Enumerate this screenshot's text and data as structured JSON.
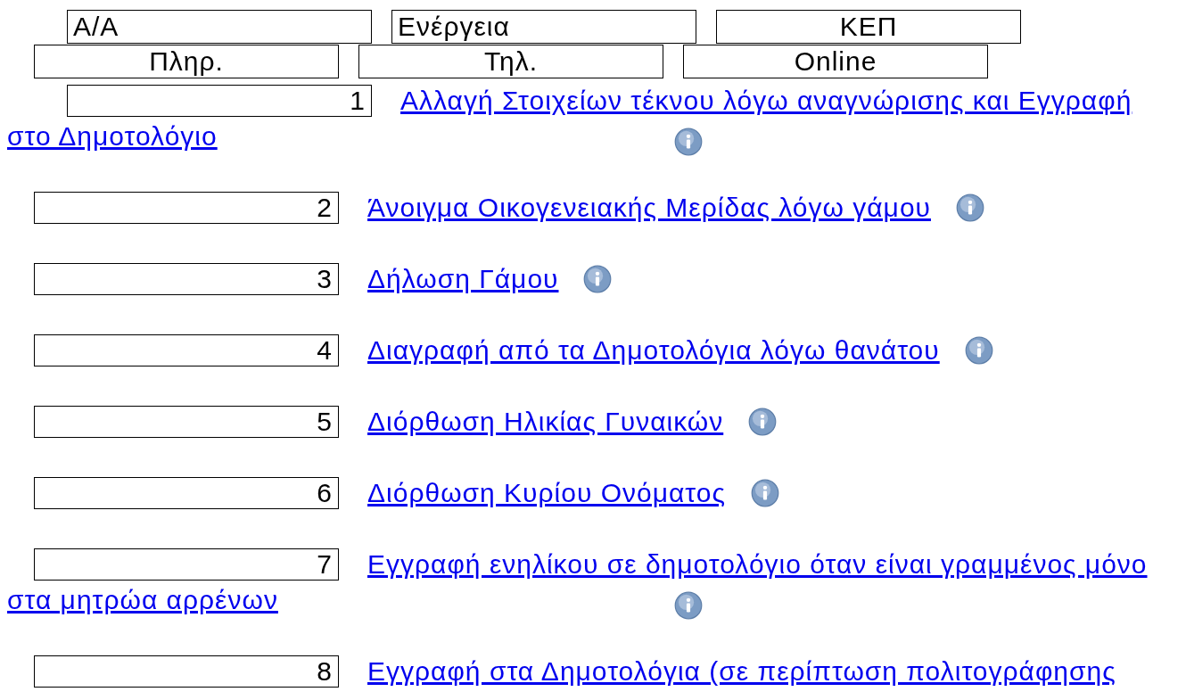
{
  "legend_rows": [
    [
      "Α/Α",
      "Ενέργεια",
      "ΚΕΠ"
    ],
    [
      "Πληρ.",
      "Τηλ.",
      "Online"
    ]
  ],
  "services": [
    {
      "number": "1",
      "title_lines": [
        "Αλλαγή Στοιχείων τέκνου λόγω αναγνώρισης και Εγγραφή",
        "στο Δημοτολόγιο"
      ],
      "info": true
    },
    {
      "number": "2",
      "title_lines": [
        "Άνοιγμα Οικογενειακής Μερίδας λόγω γάμου"
      ],
      "info": true
    },
    {
      "number": "3",
      "title_lines": [
        "Δήλωση Γάμου"
      ],
      "info": true
    },
    {
      "number": "4",
      "title_lines": [
        "Διαγραφή από τα Δημοτολόγια λόγω θανάτου"
      ],
      "info": true
    },
    {
      "number": "5",
      "title_lines": [
        "Διόρθωση Ηλικίας Γυναικών"
      ],
      "info": true
    },
    {
      "number": "6",
      "title_lines": [
        "Διόρθωση Κυρίου Ονόματος"
      ],
      "info": true
    },
    {
      "number": "7",
      "title_lines": [
        "Εγγραφή ενηλίκου σε δημοτολόγιο όταν είναι γραμμένος μόνο",
        "στα μητρώα αρρένων"
      ],
      "info": true
    },
    {
      "number": "8",
      "title_lines": [
        "Εγγραφή στα Δημοτολόγια (σε περίπτωση πολιτογράφησης"
      ],
      "info": false
    }
  ]
}
